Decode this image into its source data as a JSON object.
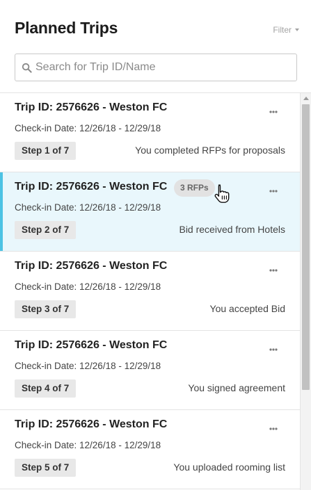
{
  "header": {
    "title": "Planned Trips",
    "filter_label": "Filter"
  },
  "search": {
    "placeholder": "Search for Trip ID/Name",
    "value": ""
  },
  "colors": {
    "active_accent": "#4dc3e4",
    "active_background": "#e9f7fc",
    "badge_background": "#e2e2e2",
    "step_background": "#e8e8e8"
  },
  "trips": [
    {
      "title": "Trip ID: 2576626 - Weston FC",
      "dates": "Check-in Date: 12/26/18 - 12/29/18",
      "step": "Step 1 of 7",
      "status": "You completed RFPs for proposals",
      "badge": "",
      "active": false
    },
    {
      "title": "Trip ID: 2576626 - Weston FC",
      "dates": "Check-in Date: 12/26/18 - 12/29/18",
      "step": "Step 2 of 7",
      "status": "Bid received from Hotels",
      "badge": "3 RFPs",
      "active": true
    },
    {
      "title": "Trip ID: 2576626 - Weston FC",
      "dates": "Check-in Date: 12/26/18 - 12/29/18",
      "step": "Step 3 of 7",
      "status": "You accepted Bid",
      "badge": "",
      "active": false
    },
    {
      "title": "Trip ID: 2576626 - Weston FC",
      "dates": "Check-in Date: 12/26/18 - 12/29/18",
      "step": "Step 4 of 7",
      "status": "You signed agreement",
      "badge": "",
      "active": false
    },
    {
      "title": "Trip ID: 2576626 - Weston FC",
      "dates": "Check-in Date: 12/26/18 - 12/29/18",
      "step": "Step 5 of 7",
      "status": "You uploaded rooming list",
      "badge": "",
      "active": false
    }
  ]
}
